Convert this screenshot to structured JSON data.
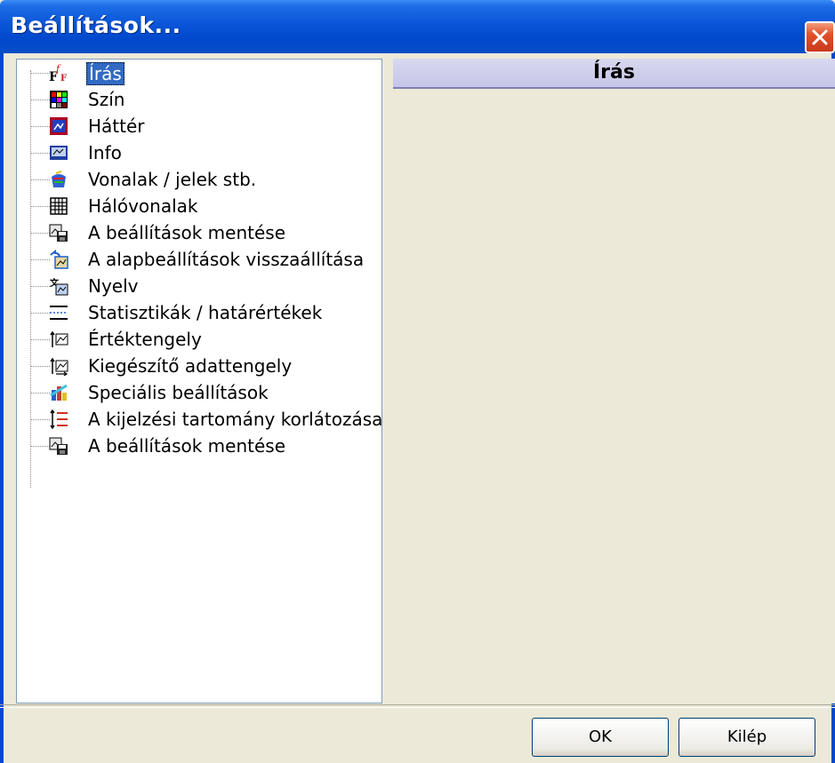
{
  "window": {
    "title": "Beállítások..."
  },
  "tree": {
    "items": [
      {
        "label": "Írás",
        "icon": "font-icon",
        "selected": true
      },
      {
        "label": "Szín",
        "icon": "color-palette-icon"
      },
      {
        "label": "Háttér",
        "icon": "background-icon"
      },
      {
        "label": "Info",
        "icon": "info-icon"
      },
      {
        "label": "Vonalak / jelek stb.",
        "icon": "lines-marks-icon"
      },
      {
        "label": "Hálóvonalak",
        "icon": "grid-icon"
      },
      {
        "label": "A beállítások mentése",
        "icon": "save-settings-icon"
      },
      {
        "label": "A alapbeállítások visszaállítása",
        "icon": "restore-defaults-icon"
      },
      {
        "label": "Nyelv",
        "icon": "language-icon"
      },
      {
        "label": "Statisztikák / határértékek",
        "icon": "statistics-icon"
      },
      {
        "label": "Értéktengely",
        "icon": "value-axis-icon"
      },
      {
        "label": "Kiegészítő adattengely",
        "icon": "secondary-axis-icon"
      },
      {
        "label": "Speciális beállítások",
        "icon": "special-settings-icon"
      },
      {
        "label": "A kijelzési tartomány korlátozása",
        "icon": "display-range-icon"
      },
      {
        "label": "A beállítások mentése",
        "icon": "save-settings-icon"
      }
    ]
  },
  "content": {
    "header": "Írás"
  },
  "buttons": {
    "ok": "OK",
    "exit": "Kilép"
  },
  "colors": {
    "titlebar": "#0a55d8",
    "selection": "#316ac5",
    "header": "#c5c5e8"
  }
}
